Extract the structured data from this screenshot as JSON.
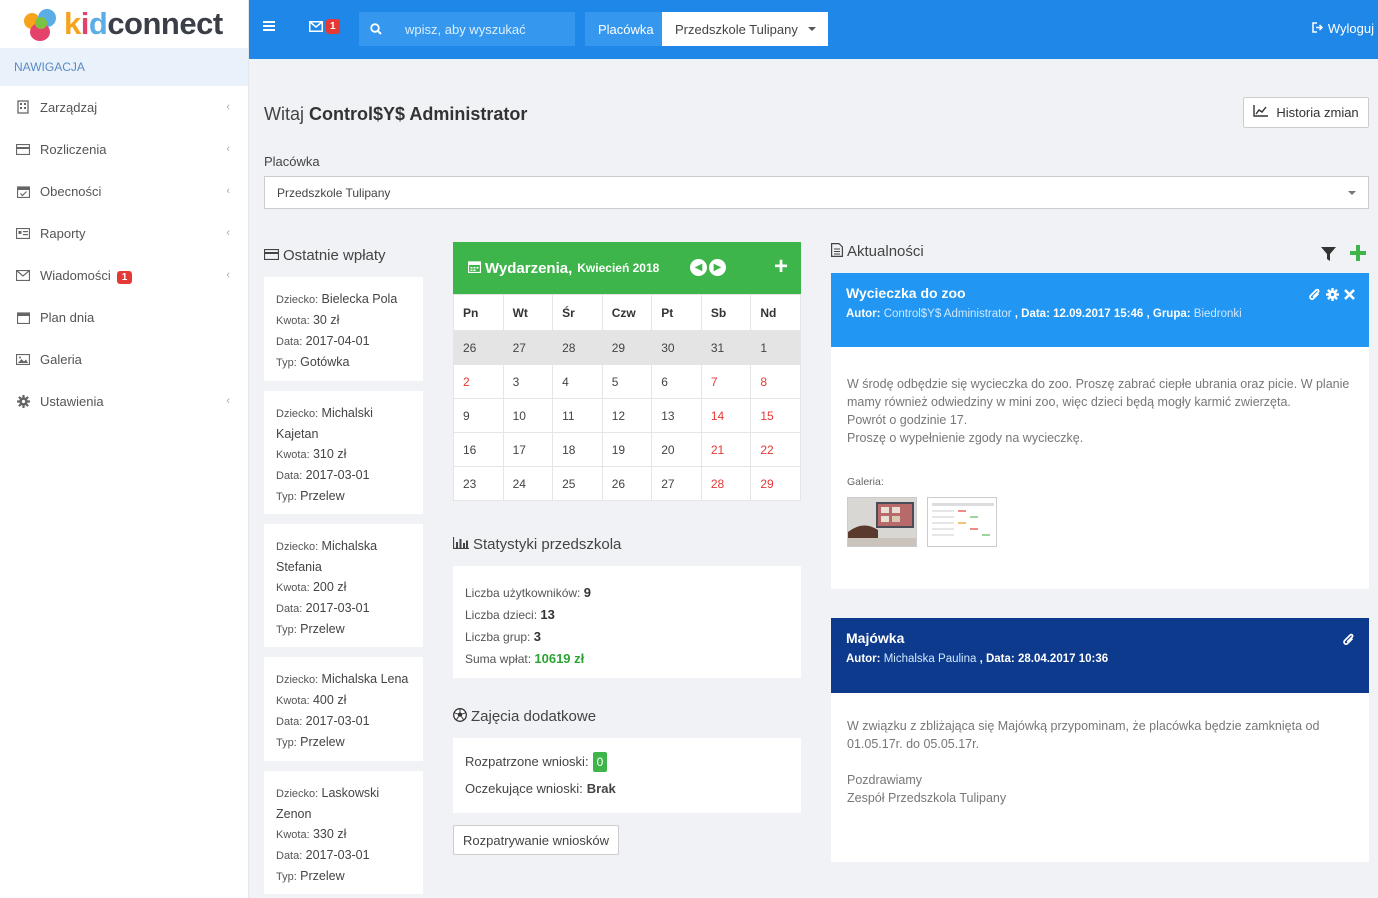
{
  "logo": {
    "kid_k": "k",
    "kid_i": "i",
    "kid_d": "d",
    "connect": "connect"
  },
  "nav": {
    "header": "NAWIGACJA",
    "items": [
      {
        "label": "Zarządzaj",
        "icon": "building-icon"
      },
      {
        "label": "Rozliczenia",
        "icon": "credit-card-icon"
      },
      {
        "label": "Obecności",
        "icon": "calendar-check-icon"
      },
      {
        "label": "Raporty",
        "icon": "id-card-icon"
      },
      {
        "label": "Wiadomości",
        "icon": "envelope-icon",
        "badge": "1"
      },
      {
        "label": "Plan dnia",
        "icon": "calendar-icon"
      },
      {
        "label": "Galeria",
        "icon": "image-icon"
      },
      {
        "label": "Ustawienia",
        "icon": "gear-icon"
      }
    ]
  },
  "topbar": {
    "mail_badge": "1",
    "search_placeholder": "wpisz, aby wyszukać",
    "placowka_label": "Placówka",
    "placowka_value": "Przedszkole Tulipany",
    "logout": "Wyloguj",
    "accent": "#1f87e8"
  },
  "header": {
    "welcome_prefix": "Witaj",
    "welcome_user": "Control$Y$ Administrator",
    "history_btn": "Historia zmian",
    "field_label": "Placówka",
    "field_value": "Przedszkole Tulipany"
  },
  "payments": {
    "title": "Ostatnie wpłaty",
    "k_child": "Dziecko:",
    "k_amount": "Kwota:",
    "k_date": "Data:",
    "k_type": "Typ:",
    "items": [
      {
        "child": "Bielecka Pola",
        "amount": "30 zł",
        "date": "2017-04-01",
        "type": "Gotówka"
      },
      {
        "child": "Michalski Kajetan",
        "amount": "310 zł",
        "date": "2017-03-01",
        "type": "Przelew"
      },
      {
        "child": "Michalska Stefania",
        "amount": "200 zł",
        "date": "2017-03-01",
        "type": "Przelew"
      },
      {
        "child": "Michalska Lena",
        "amount": "400 zł",
        "date": "2017-03-01",
        "type": "Przelew"
      },
      {
        "child": "Laskowski Zenon",
        "amount": "330 zł",
        "date": "2017-03-01",
        "type": "Przelew"
      }
    ]
  },
  "calendar": {
    "title": "Wydarzenia,",
    "month": "Kwiecień 2018",
    "days": [
      "Pn",
      "Wt",
      "Śr",
      "Czw",
      "Pt",
      "Sb",
      "Nd"
    ],
    "weeks": [
      [
        "26",
        "27",
        "28",
        "29",
        "30",
        "31",
        "1"
      ],
      [
        "2",
        "3",
        "4",
        "5",
        "6",
        "7",
        "8"
      ],
      [
        "9",
        "10",
        "11",
        "12",
        "13",
        "14",
        "15"
      ],
      [
        "16",
        "17",
        "18",
        "19",
        "20",
        "21",
        "22"
      ],
      [
        "23",
        "24",
        "25",
        "26",
        "27",
        "28",
        "29"
      ]
    ],
    "color": "#3db54a"
  },
  "stats": {
    "title": "Statystyki przedszkola",
    "users_label": "Liczba użytkowników:",
    "users": "9",
    "children_label": "Liczba dzieci:",
    "children": "13",
    "groups_label": "Liczba grup:",
    "groups": "3",
    "payments_label": "Suma wpłat:",
    "payments": "10619 zł"
  },
  "activities": {
    "title": "Zajęcia dodatkowe",
    "reviewed_label": "Rozpatrzone wnioski:",
    "reviewed": "0",
    "pending_label": "Oczekujące wnioski:",
    "pending": "Brak",
    "button": "Rozpatrywanie wniosków"
  },
  "news": {
    "title": "Aktualności",
    "items": [
      {
        "title": "Wycieczka do zoo",
        "author_label": "Autor:",
        "author": "Control$Y$ Administrator",
        "date_label": ", Data:",
        "date": "12.09.2017 15:46",
        "group_label": ", Grupa:",
        "group": "Biedronki",
        "body1": "W środę odbędzie się wycieczka do zoo. Proszę zabrać ciepłe ubrania oraz picie. W planie mamy również odwiedziny w mini zoo, więc dzieci będą mogły karmić zwierzęta.",
        "body2": "Powrót o godzinie 17.",
        "body3": "Proszę o wypełnienie zgody na wycieczkę.",
        "gallery": "Galeria:",
        "color": "#2196f3"
      },
      {
        "title": "Majówka",
        "author_label": "Autor:",
        "author": "Michalska Paulina",
        "date_label": ", Data:",
        "date": "28.04.2017 10:36",
        "body1": "W związku z zbliżająca się Majówką przypominam, że placówka będzie zamknięta od 01.05.17r. do 05.05.17r.",
        "body2": "Pozdrawiamy",
        "body3": "Zespół Przedszkola Tulipany",
        "color": "#0d3a8c"
      }
    ]
  }
}
